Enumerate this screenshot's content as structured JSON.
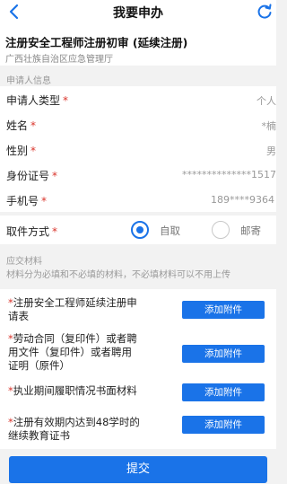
{
  "navbar": {
    "title": "我要申办",
    "back_icon": "chevron-left-icon",
    "refresh_icon": "refresh-icon"
  },
  "header": {
    "title": "注册安全工程师注册初审 (延续注册)",
    "department": "广西壮族自治区应急管理厅"
  },
  "applicant_section": {
    "label": "申请人信息"
  },
  "form": {
    "fields": [
      {
        "label": "申请人类型",
        "required": "*",
        "value": "个人"
      },
      {
        "label": "姓名",
        "required": "*",
        "value": "*楠"
      },
      {
        "label": "性别",
        "required": "*",
        "value": "男"
      },
      {
        "label": "身份证号",
        "required": "*",
        "value": "**************1517"
      },
      {
        "label": "手机号",
        "required": "*",
        "value": "189****9364"
      }
    ]
  },
  "pickup": {
    "label": "取件方式",
    "required": "*",
    "options": [
      {
        "label": "自取",
        "selected": true
      },
      {
        "label": "邮寄",
        "selected": false
      }
    ]
  },
  "materials_section": {
    "label": "应交材料",
    "note": "材料分为必填和不必填的材料，不必填材料可以不用上传"
  },
  "materials": [
    {
      "star": "*",
      "lines": [
        "注册安全工程师延续注册申",
        "请表"
      ],
      "button": "添加附件"
    },
    {
      "star": "*",
      "lines": [
        "劳动合同（复印件）或者聘",
        "用文件（复印件）或者聘用",
        "证明（原件）"
      ],
      "button": "添加附件"
    },
    {
      "star": "*",
      "lines": [
        "执业期间履职情况书面材料"
      ],
      "button": "添加附件"
    },
    {
      "star": "*",
      "lines": [
        "注册有效期内达到48学时的",
        "继续教育证书"
      ],
      "button": "添加附件"
    }
  ],
  "submit": {
    "label": "提交"
  },
  "colors": {
    "accent": "#1a73e8",
    "required": "#d9342b",
    "background": "#f2f2f2"
  }
}
